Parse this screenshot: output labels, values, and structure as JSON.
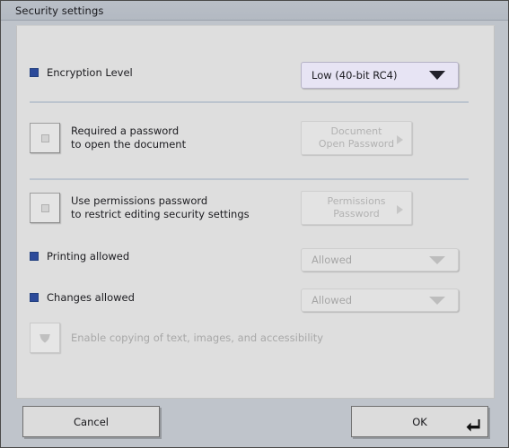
{
  "window": {
    "title": "Security settings"
  },
  "encryption": {
    "label": "Encryption Level",
    "selected": "Low (40-bit RC4)",
    "arrow_icon": "chevron-down-icon"
  },
  "open_password": {
    "line1": "Required a password",
    "line2": "to open the document",
    "button_line1": "Document",
    "button_line2": "Open Password",
    "button_arrow_icon": "chevron-right-icon",
    "toggle_icon": "unchecked-square-icon"
  },
  "permissions_password": {
    "line1": "Use permissions password",
    "line2": "to restrict editing security settings",
    "button_line1": "Permissions",
    "button_line2": "Password",
    "button_arrow_icon": "chevron-right-icon",
    "toggle_icon": "unchecked-square-icon"
  },
  "printing": {
    "label": "Printing allowed",
    "selected": "Allowed",
    "arrow_icon": "chevron-down-icon"
  },
  "changes": {
    "label": "Changes allowed",
    "selected": "Allowed",
    "arrow_icon": "chevron-down-icon"
  },
  "copying": {
    "label": "Enable copying of text, images, and accessibility",
    "toggle_icon": "checkmark-icon"
  },
  "footer": {
    "cancel_label": "Cancel",
    "ok_label": "OK",
    "ok_glyph_icon": "enter-key-icon"
  },
  "colors": {
    "titlebar": "#b6bcc4",
    "panel": "#dedede",
    "window": "#bfc4cb",
    "checkbox_blue": "#2c4a9a",
    "combo_active": "#e7e4f4",
    "separator": "#bcc4ce",
    "disabled_text": "#a8a8a8"
  }
}
